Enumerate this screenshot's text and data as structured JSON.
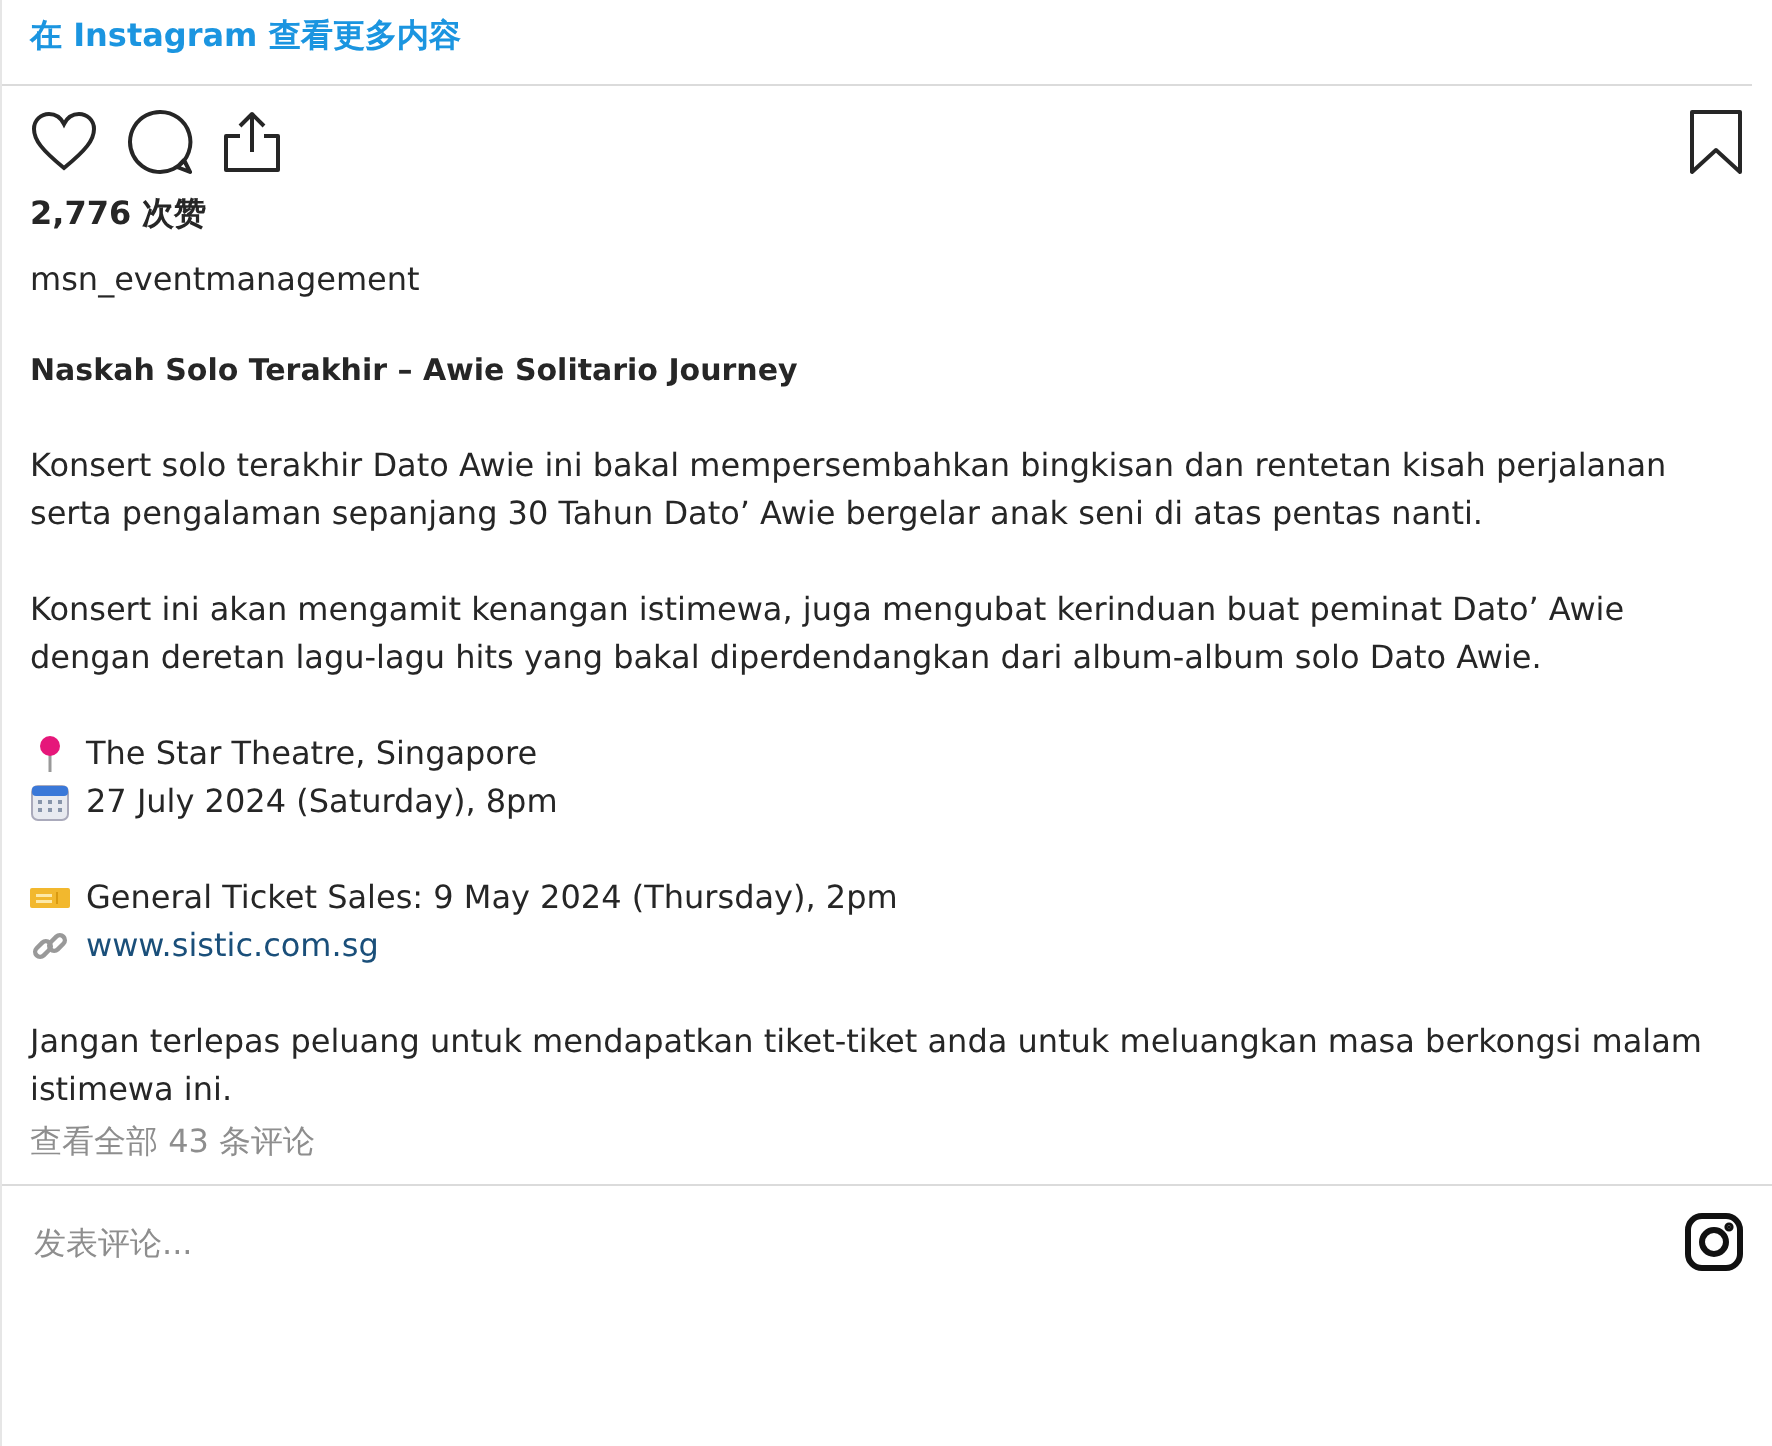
{
  "header_link": "在 Instagram 查看更多内容",
  "likes": "2,776 次赞",
  "username": "msn_eventmanagement",
  "caption": [
    {
      "kind": "title",
      "text": "Naskah Solo Terakhir – Awie Solitario Journey"
    },
    {
      "kind": "paragraph",
      "text": "Konsert solo terakhir Dato Awie ini bakal mempersembahkan bingkisan dan rentetan kisah perjalanan serta pengalaman sepanjang 30 Tahun Dato’ Awie bergelar anak seni di atas pentas nanti."
    },
    {
      "kind": "paragraph",
      "text": "Konsert ini akan mengamit kenangan istimewa, juga mengubat kerinduan buat peminat Dato’ Awie dengan deretan lagu-lagu hits yang bakal diperdendangkan dari album-album solo Dato Awie."
    },
    {
      "kind": "details",
      "lines": [
        {
          "kind": "venue",
          "text": "The Star Theatre, Singapore"
        },
        {
          "kind": "date",
          "text": "27 July 2024 (Saturday), 8pm"
        }
      ]
    },
    {
      "kind": "details",
      "lines": [
        {
          "kind": "tickets",
          "text": "General Ticket Sales: 9 May 2024 (Thursday), 2pm"
        },
        {
          "kind": "link",
          "text": "www.sistic.com.sg"
        }
      ]
    },
    {
      "kind": "paragraph",
      "text": "Jangan terlepas peluang untuk mendapatkan tiket-tiket anda untuk meluangkan masa berkongsi malam istimewa ini."
    }
  ],
  "view_comments": "查看全部 43 条评论",
  "comment_field": {
    "placeholder": "发表评论..."
  }
}
